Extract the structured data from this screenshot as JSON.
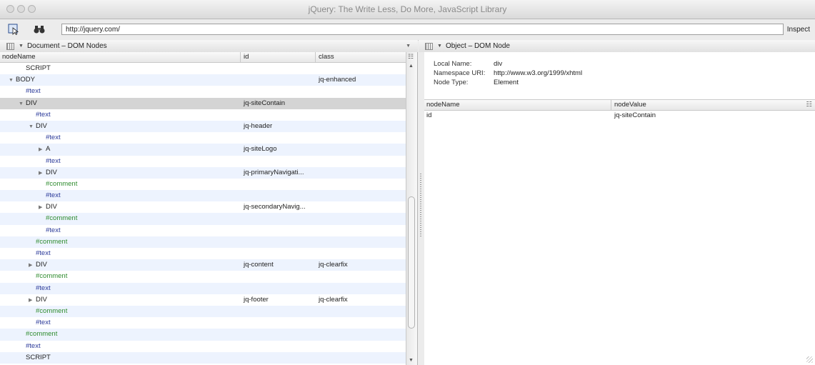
{
  "window": {
    "title": "jQuery: The Write Less, Do More, JavaScript Library"
  },
  "toolbar": {
    "url_value": "http://jquery.com/",
    "inspect_label": "Inspect"
  },
  "left_panel": {
    "header_title": "Document – DOM Nodes",
    "columns": {
      "name": "nodeName",
      "id": "id",
      "class": "class"
    },
    "rows": [
      {
        "name": "SCRIPT",
        "id": "",
        "cls": "",
        "type": "element",
        "depth": 3,
        "arrow": ""
      },
      {
        "name": "BODY",
        "id": "",
        "cls": "jq-enhanced",
        "type": "element",
        "depth": 2,
        "arrow": "open"
      },
      {
        "name": "#text",
        "id": "",
        "cls": "",
        "type": "text",
        "depth": 3,
        "arrow": ""
      },
      {
        "name": "DIV",
        "id": "jq-siteContain",
        "cls": "",
        "type": "element",
        "depth": 3,
        "arrow": "open",
        "selected": true
      },
      {
        "name": "#text",
        "id": "",
        "cls": "",
        "type": "text",
        "depth": 4,
        "arrow": ""
      },
      {
        "name": "DIV",
        "id": "jq-header",
        "cls": "",
        "type": "element",
        "depth": 4,
        "arrow": "open"
      },
      {
        "name": "#text",
        "id": "",
        "cls": "",
        "type": "text",
        "depth": 5,
        "arrow": ""
      },
      {
        "name": "A",
        "id": "jq-siteLogo",
        "cls": "",
        "type": "element",
        "depth": 5,
        "arrow": "closed"
      },
      {
        "name": "#text",
        "id": "",
        "cls": "",
        "type": "text",
        "depth": 5,
        "arrow": ""
      },
      {
        "name": "DIV",
        "id": "jq-primaryNavigati...",
        "cls": "",
        "type": "element",
        "depth": 5,
        "arrow": "closed"
      },
      {
        "name": "#comment",
        "id": "",
        "cls": "",
        "type": "comment",
        "depth": 5,
        "arrow": ""
      },
      {
        "name": "#text",
        "id": "",
        "cls": "",
        "type": "text",
        "depth": 5,
        "arrow": ""
      },
      {
        "name": "DIV",
        "id": "jq-secondaryNavig...",
        "cls": "",
        "type": "element",
        "depth": 5,
        "arrow": "closed"
      },
      {
        "name": "#comment",
        "id": "",
        "cls": "",
        "type": "comment",
        "depth": 5,
        "arrow": ""
      },
      {
        "name": "#text",
        "id": "",
        "cls": "",
        "type": "text",
        "depth": 5,
        "arrow": ""
      },
      {
        "name": "#comment",
        "id": "",
        "cls": "",
        "type": "comment",
        "depth": 4,
        "arrow": ""
      },
      {
        "name": "#text",
        "id": "",
        "cls": "",
        "type": "text",
        "depth": 4,
        "arrow": ""
      },
      {
        "name": "DIV",
        "id": "jq-content",
        "cls": "jq-clearfix",
        "type": "element",
        "depth": 4,
        "arrow": "closed"
      },
      {
        "name": "#comment",
        "id": "",
        "cls": "",
        "type": "comment",
        "depth": 4,
        "arrow": ""
      },
      {
        "name": "#text",
        "id": "",
        "cls": "",
        "type": "text",
        "depth": 4,
        "arrow": ""
      },
      {
        "name": "DIV",
        "id": "jq-footer",
        "cls": "jq-clearfix",
        "type": "element",
        "depth": 4,
        "arrow": "closed"
      },
      {
        "name": "#comment",
        "id": "",
        "cls": "",
        "type": "comment",
        "depth": 4,
        "arrow": ""
      },
      {
        "name": "#text",
        "id": "",
        "cls": "",
        "type": "text",
        "depth": 4,
        "arrow": ""
      },
      {
        "name": "#comment",
        "id": "",
        "cls": "",
        "type": "comment",
        "depth": 3,
        "arrow": ""
      },
      {
        "name": "#text",
        "id": "",
        "cls": "",
        "type": "text",
        "depth": 3,
        "arrow": ""
      },
      {
        "name": "SCRIPT",
        "id": "",
        "cls": "",
        "type": "element",
        "depth": 3,
        "arrow": ""
      }
    ]
  },
  "right_panel": {
    "header_title": "Object – DOM Node",
    "local_name_label": "Local Name:",
    "local_name_value": "div",
    "namespace_label": "Namespace URI:",
    "namespace_value": "http://www.w3.org/1999/xhtml",
    "node_type_label": "Node Type:",
    "node_type_value": "Element",
    "columns": {
      "name": "nodeName",
      "value": "nodeValue"
    },
    "rows": [
      {
        "name": "id",
        "value": "jq-siteContain"
      }
    ]
  },
  "colors": {
    "text_node": "#2b3a9a",
    "comment_node": "#2f8c2f",
    "alt_row": "#edf3fe",
    "selected_row": "#d4d4d4"
  },
  "icons": {
    "inspect_tool": "cursor-select-icon",
    "find": "binoculars-icon"
  }
}
